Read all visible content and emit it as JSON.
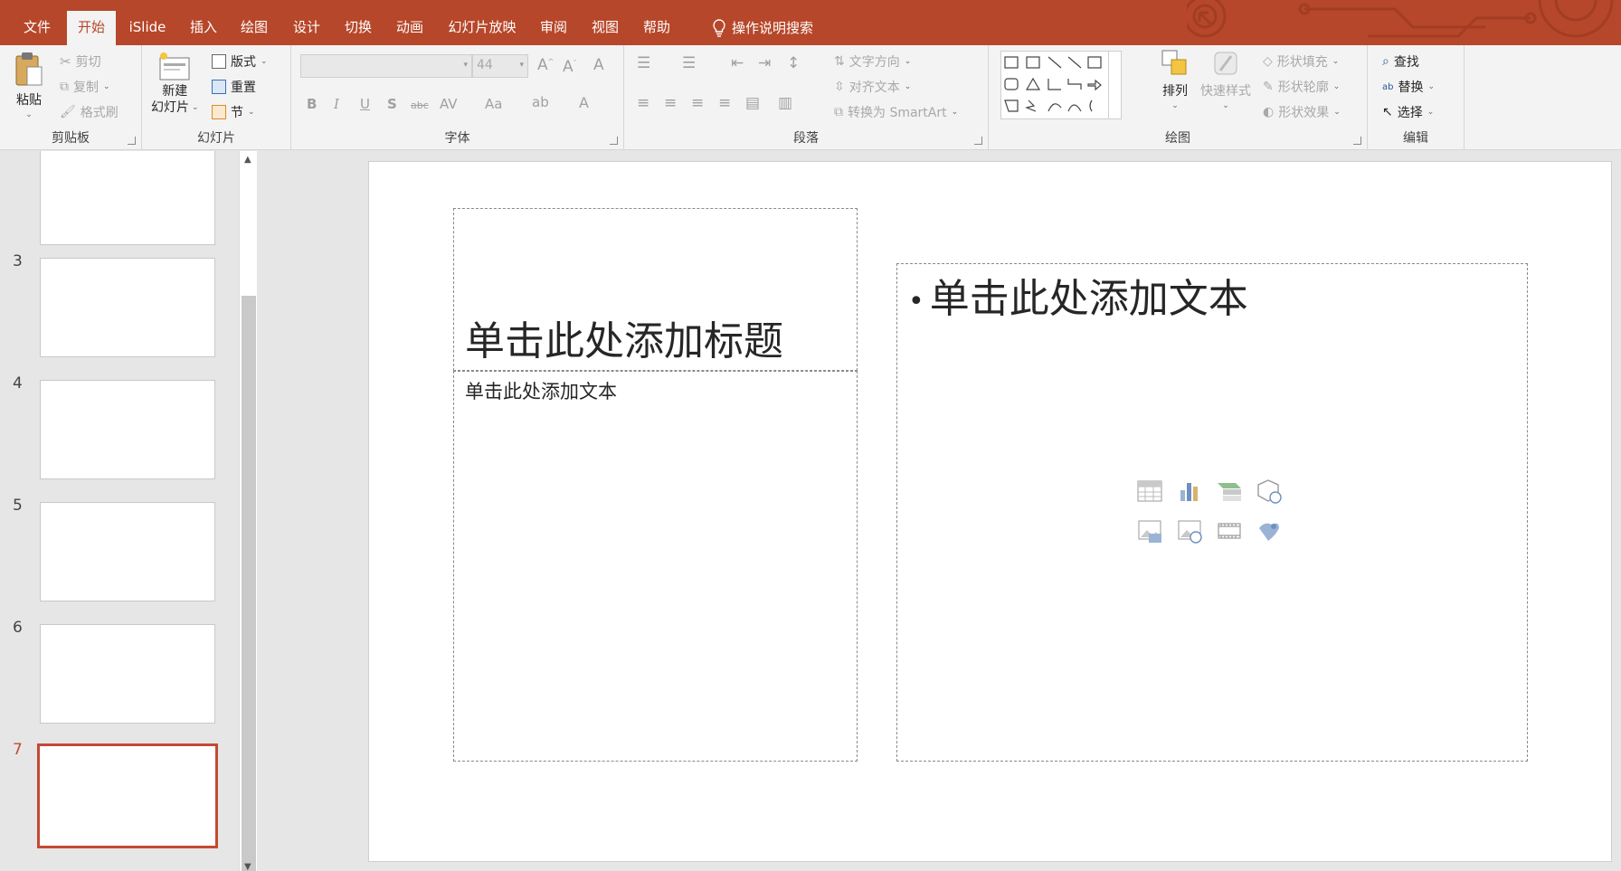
{
  "tabs": [
    "文件",
    "开始",
    "iSlide",
    "插入",
    "绘图",
    "设计",
    "切换",
    "动画",
    "幻灯片放映",
    "审阅",
    "视图",
    "帮助",
    "操作说明搜索"
  ],
  "active_tab": "开始",
  "ribbon": {
    "clipboard": {
      "label": "剪贴板",
      "paste": "粘贴",
      "cut": "剪切",
      "copy": "复制",
      "format_painter": "格式刷"
    },
    "slides": {
      "label": "幻灯片",
      "new_slide_line1": "新建",
      "new_slide_line2": "幻灯片",
      "layout": "版式",
      "reset": "重置",
      "section": "节"
    },
    "font": {
      "label": "字体",
      "font_name": "",
      "font_size": "44"
    },
    "paragraph": {
      "label": "段落",
      "text_direction": "文字方向",
      "align_text": "对齐文本",
      "smartart": "转换为 SmartArt"
    },
    "drawing": {
      "label": "绘图",
      "arrange": "排列",
      "quick_styles": "快速样式",
      "shape_fill": "形状填充",
      "shape_outline": "形状轮廓",
      "shape_effects": "形状效果"
    },
    "editing": {
      "label": "编辑",
      "find": "查找",
      "replace": "替换",
      "select": "选择"
    }
  },
  "thumbnails": {
    "numbers": [
      "3",
      "4",
      "5",
      "6",
      "7"
    ],
    "selected": "7"
  },
  "slide": {
    "title_placeholder": "单击此处添加标题",
    "subtitle_placeholder": "单击此处添加文本",
    "body_bullet": "•",
    "body_placeholder": "单击此处添加文本",
    "insert_icons": [
      "table-icon",
      "chart-icon",
      "smartart-icon",
      "3d-model-icon",
      "picture-icon",
      "online-picture-icon",
      "video-icon",
      "icons-icon"
    ]
  },
  "colors": {
    "accent": "#b7472a",
    "selection": "#c24a34"
  }
}
